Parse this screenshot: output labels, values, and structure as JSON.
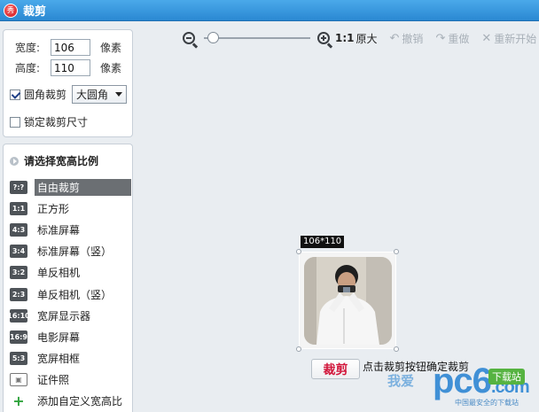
{
  "window": {
    "title": "裁剪",
    "logo_text": "秀"
  },
  "size_panel": {
    "width_label": "宽度:",
    "width_value": "106",
    "height_label": "高度:",
    "height_value": "110",
    "unit": "像素",
    "round_corner_label": "圆角裁剪",
    "round_corner_checked": true,
    "corner_select_value": "大圆角",
    "lock_size_label": "锁定裁剪尺寸",
    "lock_size_checked": false
  },
  "ratio_panel": {
    "heading": "请选择宽高比例",
    "items": [
      {
        "icon": "?:?",
        "label": "自由裁剪",
        "active": true
      },
      {
        "icon": "1:1",
        "label": "正方形"
      },
      {
        "icon": "4:3",
        "label": "标准屏幕"
      },
      {
        "icon": "3:4",
        "label": "标准屏幕（竖）"
      },
      {
        "icon": "3:2",
        "label": "单反相机"
      },
      {
        "icon": "2:3",
        "label": "单反相机（竖）"
      },
      {
        "icon": "16:10",
        "label": "宽屏显示器"
      },
      {
        "icon": "16:9",
        "label": "电影屏幕"
      },
      {
        "icon": "5:3",
        "label": "宽屏相框"
      },
      {
        "icon": "id-card-icon",
        "label": "证件照"
      },
      {
        "icon": "plus-icon",
        "label": "添加自定义宽高比"
      }
    ]
  },
  "toolbar": {
    "zoom_level": 0.04,
    "actual_size_label": "原大",
    "actual_size_ratio": "1:1",
    "undo_label": "撤销",
    "redo_label": "重做",
    "reset_label": "重新开始"
  },
  "canvas": {
    "size_tag": "106*110",
    "crop_button_label": "裁剪",
    "tip_text": "点击裁剪按钮确定裁剪"
  },
  "watermark": {
    "left_text": "我爱",
    "main_text": "pc6",
    "suffix_text": ".com",
    "badge_text": "下载站",
    "sub_text": "中国最安全的下载站"
  }
}
